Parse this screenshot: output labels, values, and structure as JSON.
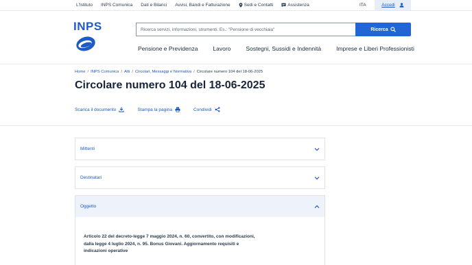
{
  "topbar": {
    "links": [
      {
        "label": "L'Istituto",
        "icon": ""
      },
      {
        "label": "INPS Comunica",
        "icon": ""
      },
      {
        "label": "Dati e Bilanci",
        "icon": ""
      },
      {
        "label": "Avvisi, Bandi e Fatturazione",
        "icon": ""
      },
      {
        "label": "Sedi e Contatti",
        "icon": "map-pin-icon"
      },
      {
        "label": "Assistenza",
        "icon": "chat-icon"
      }
    ],
    "language": "ITA",
    "login_label": "Accedi"
  },
  "logo": {
    "text": "INPS",
    "color": "#1e5bc6"
  },
  "search": {
    "placeholder": "Ricerca servizi, informazioni, strumenti. Es.: \"Pensione di vecchiaia\"",
    "button_label": "Ricerca"
  },
  "main_nav": [
    "Pensione e Previdenza",
    "Lavoro",
    "Sostegni, Sussidi e Indennità",
    "Imprese e Liberi Professionisti"
  ],
  "breadcrumb": {
    "items": [
      "Home",
      "INPS Comunica",
      "Atti",
      "Circolari, Messaggi e Normativa"
    ],
    "current": "Circolare numero 104 del 18-06-2025"
  },
  "page_title": "Circolare numero 104 del 18-06-2025",
  "actions": {
    "download": "Scarica il documento",
    "print": "Stampa la pagina",
    "share": "Condividi"
  },
  "accordions": [
    {
      "label": "Mittenti",
      "open": false
    },
    {
      "label": "Destinatari",
      "open": false
    },
    {
      "label": "Oggetto",
      "open": true,
      "body": "Articolo 22 del decreto-legge 7 maggio 2024, n. 60, convertito, con modificazioni, dalla legge 4 luglio 2024, n. 95. Bonus Giovani. Aggiornamento requisiti e indicazioni operative"
    }
  ],
  "colors": {
    "accent": "#1b57c4",
    "button": "#2266d6",
    "title": "#17243a"
  }
}
